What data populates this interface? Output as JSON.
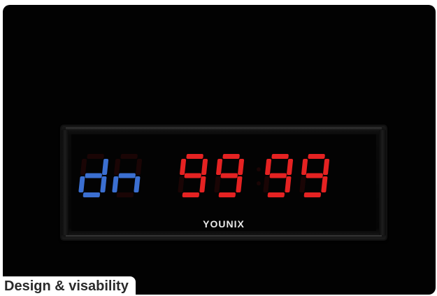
{
  "display": {
    "mode_text": "dn",
    "time_text": "99:99",
    "mode_color": "#3b6fd1",
    "time_color": "#e52222",
    "unlit_color": "#1a0505"
  },
  "brand": {
    "name": "YOUNIX"
  },
  "caption": {
    "text": "Design & visability"
  },
  "colors": {
    "background": "#020202",
    "caption_bg": "#ffffff"
  }
}
